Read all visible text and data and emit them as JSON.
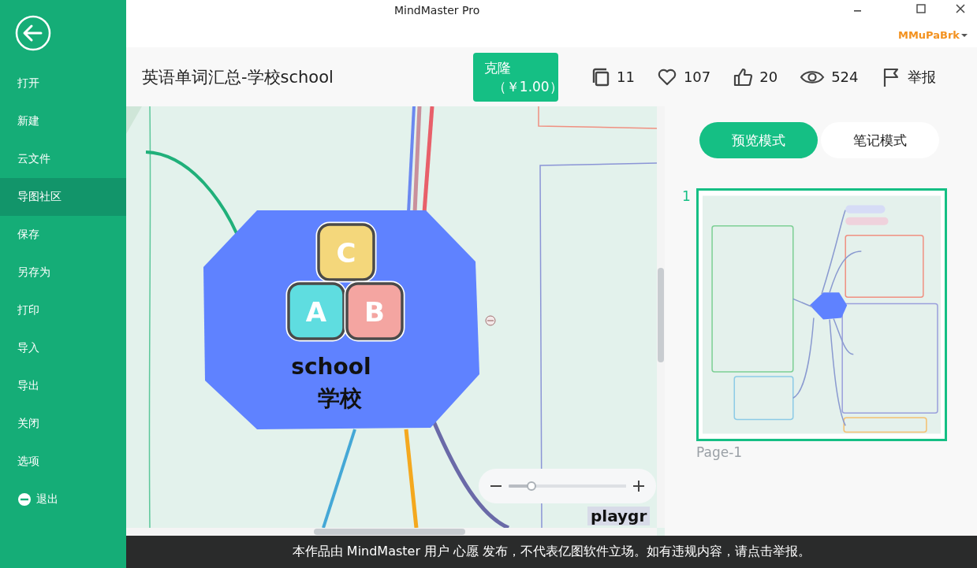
{
  "window": {
    "title": "MindMaster Pro",
    "user": "MMuPaBrk"
  },
  "sidebar": {
    "items": [
      {
        "label": "打开",
        "kind": "text",
        "selected": false
      },
      {
        "label": "新建",
        "kind": "text",
        "selected": false
      },
      {
        "label": "云文件",
        "kind": "text",
        "selected": false
      },
      {
        "label": "导图社区",
        "kind": "text",
        "selected": true
      },
      {
        "label": "保存",
        "kind": "text",
        "selected": false
      },
      {
        "label": "另存为",
        "kind": "text",
        "selected": false
      },
      {
        "label": "打印",
        "kind": "text",
        "selected": false
      },
      {
        "label": "导入",
        "kind": "text",
        "selected": false
      },
      {
        "label": "导出",
        "kind": "text",
        "selected": false
      },
      {
        "label": "关闭",
        "kind": "text",
        "selected": false
      },
      {
        "label": "选项",
        "kind": "text",
        "selected": false
      },
      {
        "label": "退出",
        "kind": "exit",
        "selected": false
      }
    ]
  },
  "document": {
    "title": "英语单词汇总-学校school",
    "clone_button": {
      "label": "克隆",
      "price": "（￥1.00）"
    },
    "stats": [
      {
        "kind": "copies",
        "value": "11"
      },
      {
        "kind": "favorites",
        "value": "107"
      },
      {
        "kind": "likes",
        "value": "20"
      },
      {
        "kind": "views",
        "value": "524"
      },
      {
        "kind": "report",
        "value": "举报"
      }
    ]
  },
  "canvas": {
    "central_topic": {
      "blocks": [
        {
          "letter": "C",
          "color": "#f4d77b"
        },
        {
          "letter": "A",
          "color": "#5fdde0"
        },
        {
          "letter": "B",
          "color": "#f4a5a1"
        }
      ],
      "lines": [
        "school",
        "学校"
      ]
    },
    "partial_topic": "playgr",
    "zoom": {
      "level": 0.2
    }
  },
  "right_panel": {
    "modes": [
      {
        "label": "预览模式",
        "selected": true
      },
      {
        "label": "笔记模式",
        "selected": false
      }
    ],
    "pages": [
      {
        "number": "1",
        "label": "Page-1",
        "selected": true
      }
    ]
  },
  "footer": "本作品由 MindMaster 用户 心愿 发布，不代表亿图软件立场。如有违规内容，请点击举报。"
}
